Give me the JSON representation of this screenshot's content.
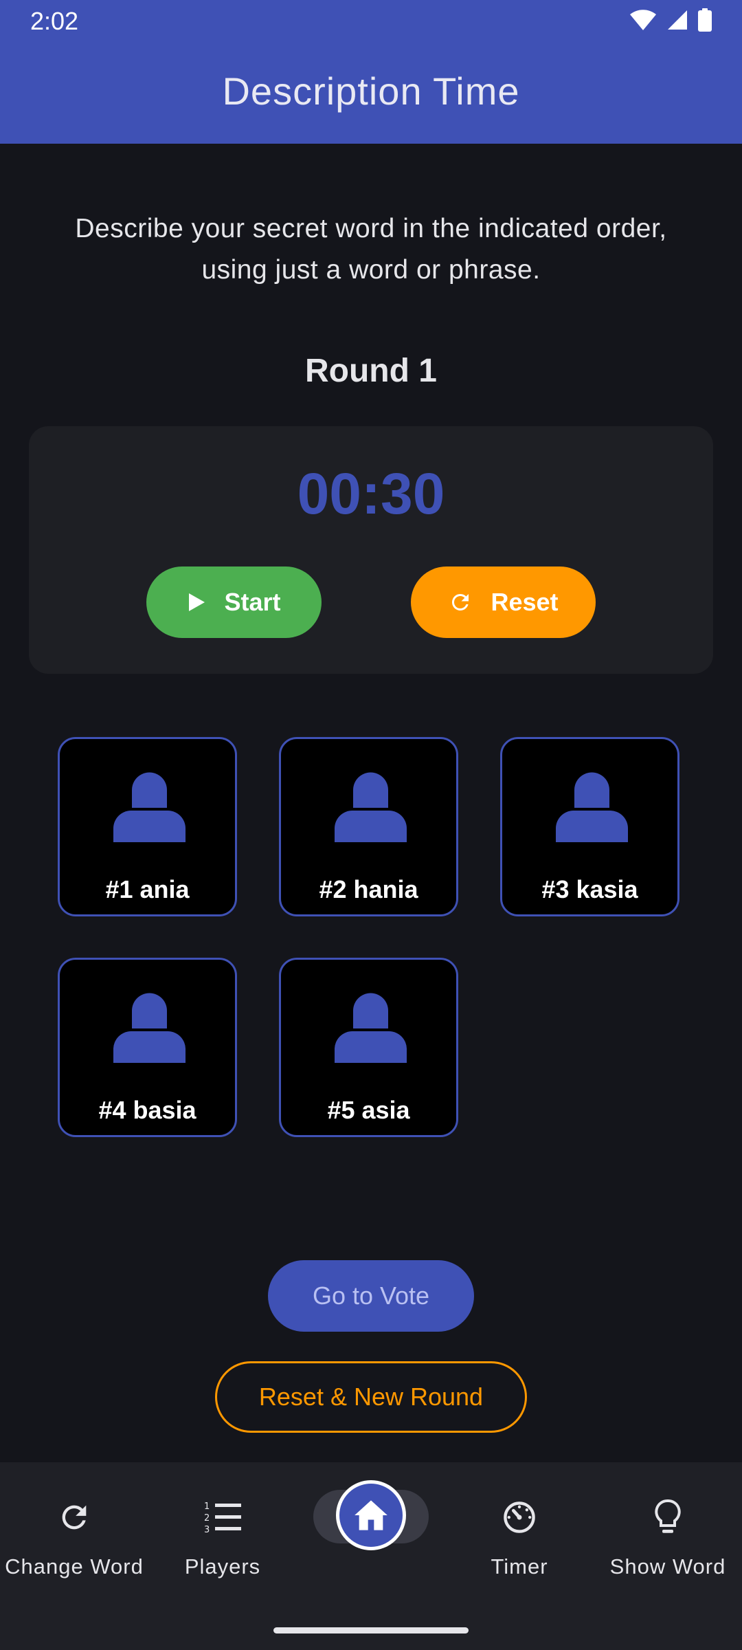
{
  "status_bar": {
    "time": "2:02"
  },
  "app_bar": {
    "title": "Description Time"
  },
  "instructions": "Describe your secret word in the indicated order, using just a word or phrase.",
  "round": {
    "label": "Round 1"
  },
  "timer": {
    "value": "00:30",
    "start_label": "Start",
    "reset_label": "Reset"
  },
  "players": [
    {
      "label": "#1 ania"
    },
    {
      "label": "#2 hania"
    },
    {
      "label": "#3 kasia"
    },
    {
      "label": "#4 basia"
    },
    {
      "label": "#5 asia"
    }
  ],
  "actions": {
    "vote_label": "Go to Vote",
    "new_round_label": "Reset & New Round"
  },
  "bottom_nav": {
    "items": [
      {
        "label": "Change Word",
        "icon": "refresh-icon"
      },
      {
        "label": "Players",
        "icon": "numbered-list-icon"
      },
      {
        "label": "",
        "icon": "home-icon"
      },
      {
        "label": "Timer",
        "icon": "timer-icon"
      },
      {
        "label": "Show Word",
        "icon": "lightbulb-icon"
      }
    ]
  },
  "colors": {
    "primary": "#3f51b5",
    "start": "#4caf50",
    "reset": "#ff9800",
    "background": "#14151b"
  }
}
